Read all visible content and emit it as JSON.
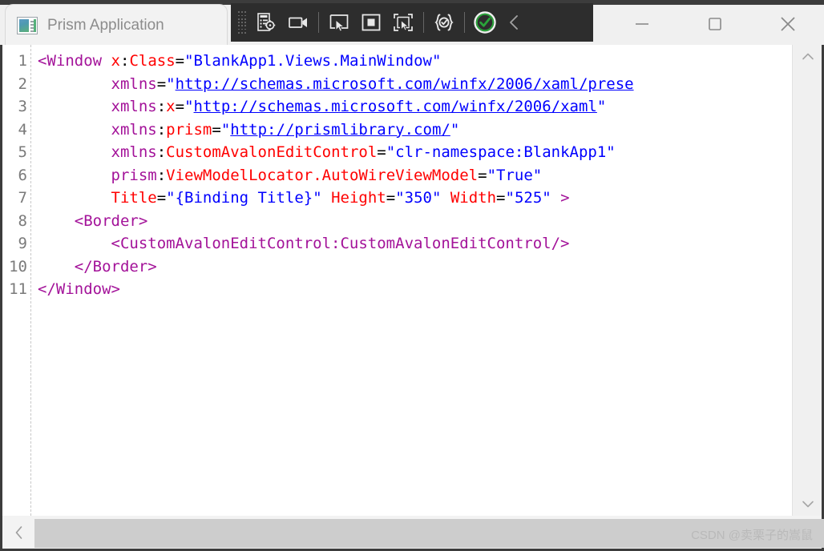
{
  "window": {
    "app_title": "Prism Application",
    "app_icon": "application-window-icon",
    "controls": {
      "minimize": "minimize-button",
      "maximize": "maximize-button",
      "close": "close-button"
    }
  },
  "toolbar": {
    "grip": "drag-grip",
    "buttons": [
      {
        "name": "go-to-live-visual-tree-icon",
        "tooltip": "Go to Live Visual Tree"
      },
      {
        "name": "record-icon",
        "tooltip": "Enable/Disable Recording"
      },
      {
        "name": "select-element-icon",
        "tooltip": "Select Element"
      },
      {
        "name": "display-layout-adorners-icon",
        "tooltip": "Display Layout Adorners"
      },
      {
        "name": "track-focused-element-icon",
        "tooltip": "Track Focused Element"
      },
      {
        "name": "xaml-hot-reload-icon",
        "tooltip": "XAML Hot Reload"
      },
      {
        "name": "hot-reload-status-ok-icon",
        "tooltip": "Hot Reload Active"
      }
    ],
    "collapse": "collapse-toolbar-chevron",
    "accent_green": "#2aa43a",
    "background": "#2d2d2d"
  },
  "editor": {
    "line_numbers": [
      "1",
      "2",
      "3",
      "4",
      "5",
      "6",
      "7",
      "8",
      "9",
      "10",
      "11"
    ],
    "colors": {
      "tag": "#a31299",
      "attribute": "#ff0000",
      "value": "#0000ff",
      "text": "#000000",
      "gutter": "#7a7a7a"
    },
    "lines": [
      [
        {
          "t": "tag",
          "s": "<Window"
        },
        {
          "t": "text",
          "s": " "
        },
        {
          "t": "attr",
          "s": "x"
        },
        {
          "t": "punct",
          "s": ":"
        },
        {
          "t": "attr",
          "s": "Class"
        },
        {
          "t": "punct",
          "s": "="
        },
        {
          "t": "val",
          "s": "\"BlankApp1.Views.MainWindow\""
        }
      ],
      [
        {
          "t": "text",
          "s": "        "
        },
        {
          "t": "ns",
          "s": "xmlns"
        },
        {
          "t": "punct",
          "s": "="
        },
        {
          "t": "val",
          "s": "\""
        },
        {
          "t": "link",
          "s": "http://schemas.microsoft.com/winfx/2006/xaml/prese"
        }
      ],
      [
        {
          "t": "text",
          "s": "        "
        },
        {
          "t": "ns",
          "s": "xmlns"
        },
        {
          "t": "punct",
          "s": ":"
        },
        {
          "t": "attr",
          "s": "x"
        },
        {
          "t": "punct",
          "s": "="
        },
        {
          "t": "val",
          "s": "\""
        },
        {
          "t": "link",
          "s": "http://schemas.microsoft.com/winfx/2006/xaml"
        },
        {
          "t": "val",
          "s": "\""
        }
      ],
      [
        {
          "t": "text",
          "s": "        "
        },
        {
          "t": "ns",
          "s": "xmlns"
        },
        {
          "t": "punct",
          "s": ":"
        },
        {
          "t": "attr",
          "s": "prism"
        },
        {
          "t": "punct",
          "s": "="
        },
        {
          "t": "val",
          "s": "\""
        },
        {
          "t": "link",
          "s": "http://prismlibrary.com/"
        },
        {
          "t": "val",
          "s": "\""
        }
      ],
      [
        {
          "t": "text",
          "s": "        "
        },
        {
          "t": "ns",
          "s": "xmlns"
        },
        {
          "t": "punct",
          "s": ":"
        },
        {
          "t": "attr",
          "s": "CustomAvalonEditControl"
        },
        {
          "t": "punct",
          "s": "="
        },
        {
          "t": "val",
          "s": "\"clr-namespace:BlankApp1\""
        }
      ],
      [
        {
          "t": "text",
          "s": "        "
        },
        {
          "t": "ns",
          "s": "prism"
        },
        {
          "t": "punct",
          "s": ":"
        },
        {
          "t": "attr",
          "s": "ViewModelLocator.AutoWireViewModel"
        },
        {
          "t": "punct",
          "s": "="
        },
        {
          "t": "val",
          "s": "\"True\""
        }
      ],
      [
        {
          "t": "text",
          "s": "        "
        },
        {
          "t": "attr",
          "s": "Title"
        },
        {
          "t": "punct",
          "s": "="
        },
        {
          "t": "val",
          "s": "\"{Binding Title}\""
        },
        {
          "t": "text",
          "s": " "
        },
        {
          "t": "attr",
          "s": "Height"
        },
        {
          "t": "punct",
          "s": "="
        },
        {
          "t": "val",
          "s": "\"350\""
        },
        {
          "t": "text",
          "s": " "
        },
        {
          "t": "attr",
          "s": "Width"
        },
        {
          "t": "punct",
          "s": "="
        },
        {
          "t": "val",
          "s": "\"525\""
        },
        {
          "t": "text",
          "s": " "
        },
        {
          "t": "tag",
          "s": ">"
        }
      ],
      [
        {
          "t": "text",
          "s": "    "
        },
        {
          "t": "tag",
          "s": "<Border>"
        }
      ],
      [
        {
          "t": "text",
          "s": "        "
        },
        {
          "t": "tag",
          "s": "<CustomAvalonEditControl:CustomAvalonEditControl/>"
        }
      ],
      [
        {
          "t": "text",
          "s": "    "
        },
        {
          "t": "tag",
          "s": "</Border>"
        }
      ],
      [
        {
          "t": "tag",
          "s": "</Window>"
        }
      ]
    ]
  },
  "scrollbars": {
    "vertical": {
      "up": "scroll-up-arrow",
      "down": "scroll-down-arrow",
      "thumb": "vertical-scroll-thumb"
    },
    "horizontal": {
      "left": "scroll-left-arrow",
      "thumb": "horizontal-scroll-thumb"
    }
  },
  "watermark": {
    "text": "CSDN @卖栗子的嵩鼠"
  }
}
